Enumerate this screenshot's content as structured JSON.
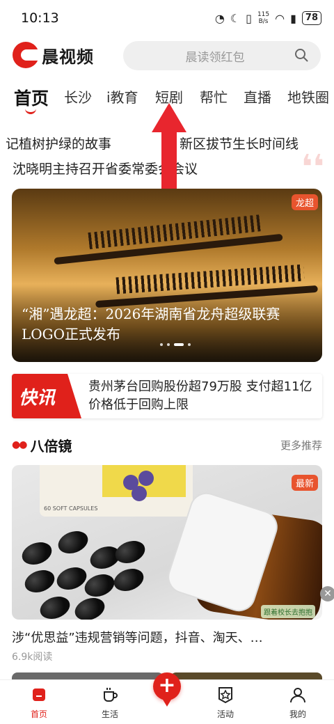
{
  "status_bar": {
    "time": "10:13",
    "net_speed_value": "115",
    "net_speed_unit": "B/s",
    "battery": "78"
  },
  "header": {
    "app_name": "晨视频",
    "search_placeholder": "晨读领红包"
  },
  "tabs": [
    {
      "label": "首页",
      "active": true
    },
    {
      "label": "长沙"
    },
    {
      "label": "i教育"
    },
    {
      "label": "短剧"
    },
    {
      "label": "帮忙"
    },
    {
      "label": "直播"
    },
    {
      "label": "地铁圈"
    }
  ],
  "ticker": {
    "line1_left": "记植树护绿的故事",
    "line1_right": "新区拔节生长时间线",
    "line2": "沈晓明主持召开省委常委会会议"
  },
  "hero": {
    "tag": "龙超",
    "title": "“湘”遇龙超：2026年湖南省龙舟超级联赛LOGO正式发布",
    "slide_count": 4,
    "active_slide": 3
  },
  "flash": {
    "badge": "快讯",
    "text": "贵州茅台回购股份超79万股 支付超11亿 价格低于回购上限"
  },
  "section": {
    "title": "八倍镜",
    "more": "更多推荐"
  },
  "article": {
    "tag": "最新",
    "image_text": "60 SOFT CAPSULES",
    "watermark": "跟着校长去抱抱",
    "title": "涉“优思益”违规营销等问题，抖音、淘天、…",
    "reads": "6.9k阅读"
  },
  "bottom_nav": [
    {
      "label": "首页",
      "icon": "home-icon",
      "active": true
    },
    {
      "label": "生活",
      "icon": "coffee-icon"
    },
    {
      "label": "活动",
      "icon": "star-badge-icon"
    },
    {
      "label": "我的",
      "icon": "person-icon"
    }
  ],
  "fab_label": "+",
  "colors": {
    "brand_red": "#e0211b",
    "tag_orange": "#e8542e"
  }
}
